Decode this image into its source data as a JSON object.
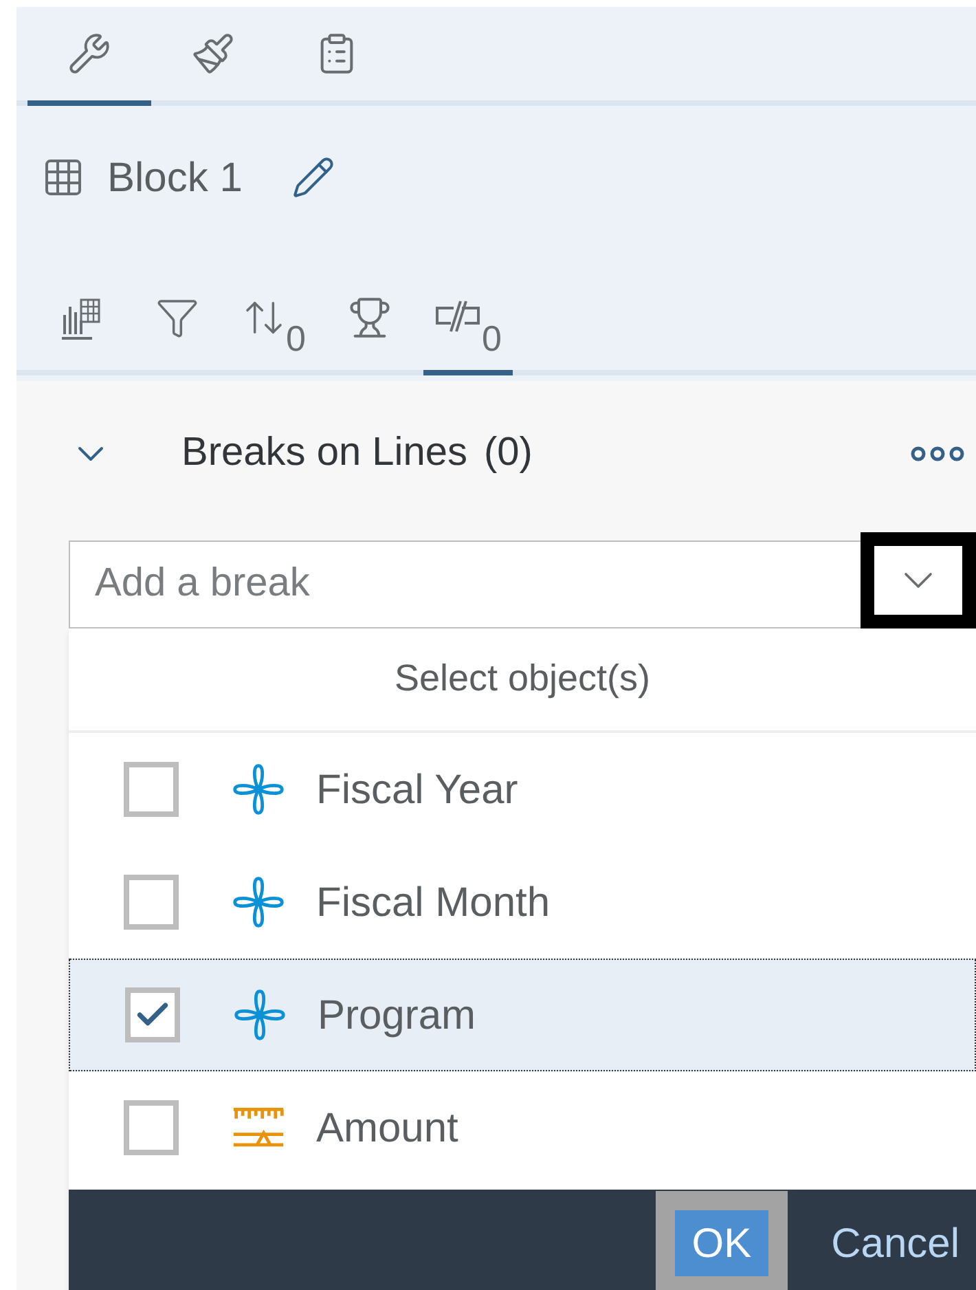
{
  "top_tabs": [
    {
      "kind": "tools",
      "selected": true
    },
    {
      "kind": "format",
      "selected": false
    },
    {
      "kind": "notes",
      "selected": false
    }
  ],
  "block": {
    "title": "Block 1"
  },
  "sub_tabs": [
    {
      "kind": "data",
      "selected": false
    },
    {
      "kind": "filter",
      "selected": false
    },
    {
      "kind": "sort",
      "count": "0",
      "selected": false
    },
    {
      "kind": "ranking",
      "selected": false
    },
    {
      "kind": "breaks",
      "count": "0",
      "selected": true
    }
  ],
  "section": {
    "title": "Breaks on Lines",
    "count": "(0)",
    "expanded": true
  },
  "break_field": {
    "placeholder": "Add a break",
    "outlined": true
  },
  "dropdown": {
    "title": "Select object(s)",
    "items": [
      {
        "label": "Fiscal Year",
        "kind": "dimension",
        "checked": false,
        "selected": false
      },
      {
        "label": "Fiscal Month",
        "kind": "dimension",
        "checked": false,
        "selected": false
      },
      {
        "label": "Program",
        "kind": "dimension",
        "checked": true,
        "selected": true
      },
      {
        "label": "Amount",
        "kind": "measure",
        "checked": false,
        "selected": false
      }
    ],
    "buttons": [
      {
        "label": "OK",
        "kind": "primary",
        "outlined": true
      },
      {
        "label": "Cancel",
        "kind": "plain",
        "outlined": false
      }
    ]
  }
}
